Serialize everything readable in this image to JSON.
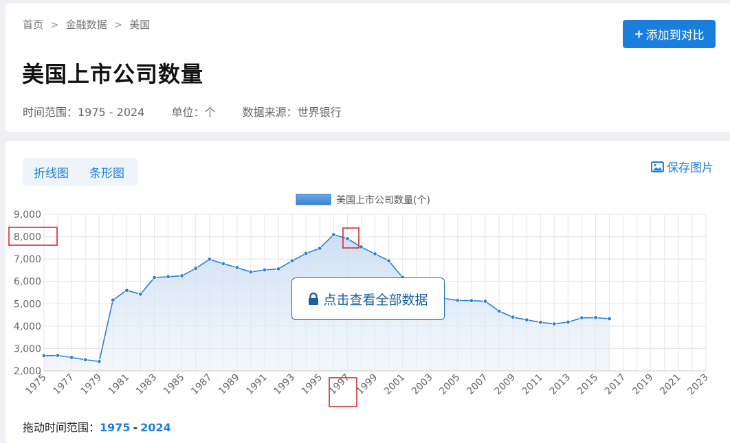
{
  "breadcrumb": [
    "首页",
    "金融数据",
    "美国"
  ],
  "breadcrumb_sep": ">",
  "title": "美国上市公司数量",
  "meta": {
    "time_range": "时间范围：1975 - 2024",
    "unit": "单位：个",
    "source": "数据来源：世界银行"
  },
  "add_button": "添加到对比",
  "add_button_icon": "plus-icon",
  "tabs": [
    "折线图",
    "条形图"
  ],
  "save_image": "保存图片",
  "save_image_icon": "image-icon",
  "overlay_button": "点击查看全部数据",
  "overlay_icon": "lock-icon",
  "range_label": "拖动时间范围：",
  "range_start": "1975",
  "range_end": "2024",
  "colors": {
    "accent": "#1a7fdc",
    "line": "#2a7fd4",
    "highlight_box": "#d9282f"
  },
  "chart_data": {
    "type": "area",
    "legend": "美国上市公司数量(个)",
    "legend_position": "top-center",
    "grid": true,
    "ylim": [
      2000,
      9000
    ],
    "yticks": [
      "9,000",
      "8,000",
      "7,000",
      "6,000",
      "5,000",
      "4,000",
      "3,000",
      "2,000"
    ],
    "xticks": [
      "1975",
      "1977",
      "1979",
      "1981",
      "1983",
      "1985",
      "1987",
      "1989",
      "1991",
      "1993",
      "1995",
      "1997",
      "1999",
      "2001",
      "2003",
      "2005",
      "2007",
      "2009",
      "2011",
      "2013",
      "2015",
      "2017",
      "2019",
      "2021",
      "2023"
    ],
    "xlim": [
      1975,
      2023
    ],
    "series": [
      {
        "name": "美国上市公司数量(个)",
        "x": [
          1975,
          1976,
          1977,
          1978,
          1979,
          1980,
          1981,
          1982,
          1983,
          1984,
          1985,
          1986,
          1987,
          1988,
          1989,
          1990,
          1991,
          1992,
          1993,
          1994,
          1995,
          1996,
          1997,
          1998,
          1999,
          2000,
          2001,
          2002,
          2003,
          2004,
          2005,
          2006,
          2007,
          2008,
          2009,
          2010,
          2011,
          2012,
          2013,
          2014,
          2015,
          2016
        ],
        "values": [
          2680,
          2690,
          2600,
          2500,
          2420,
          5170,
          5600,
          5430,
          6170,
          6210,
          6250,
          6580,
          6990,
          6790,
          6620,
          6420,
          6510,
          6560,
          6920,
          7250,
          7480,
          8090,
          7910,
          7540,
          7230,
          6920,
          6180,
          5900,
          5600,
          5240,
          5150,
          5140,
          5110,
          4670,
          4400,
          4280,
          4170,
          4100,
          4180,
          4370,
          4380,
          4330
        ]
      }
    ],
    "highlights": [
      "8,000",
      "1997"
    ]
  }
}
